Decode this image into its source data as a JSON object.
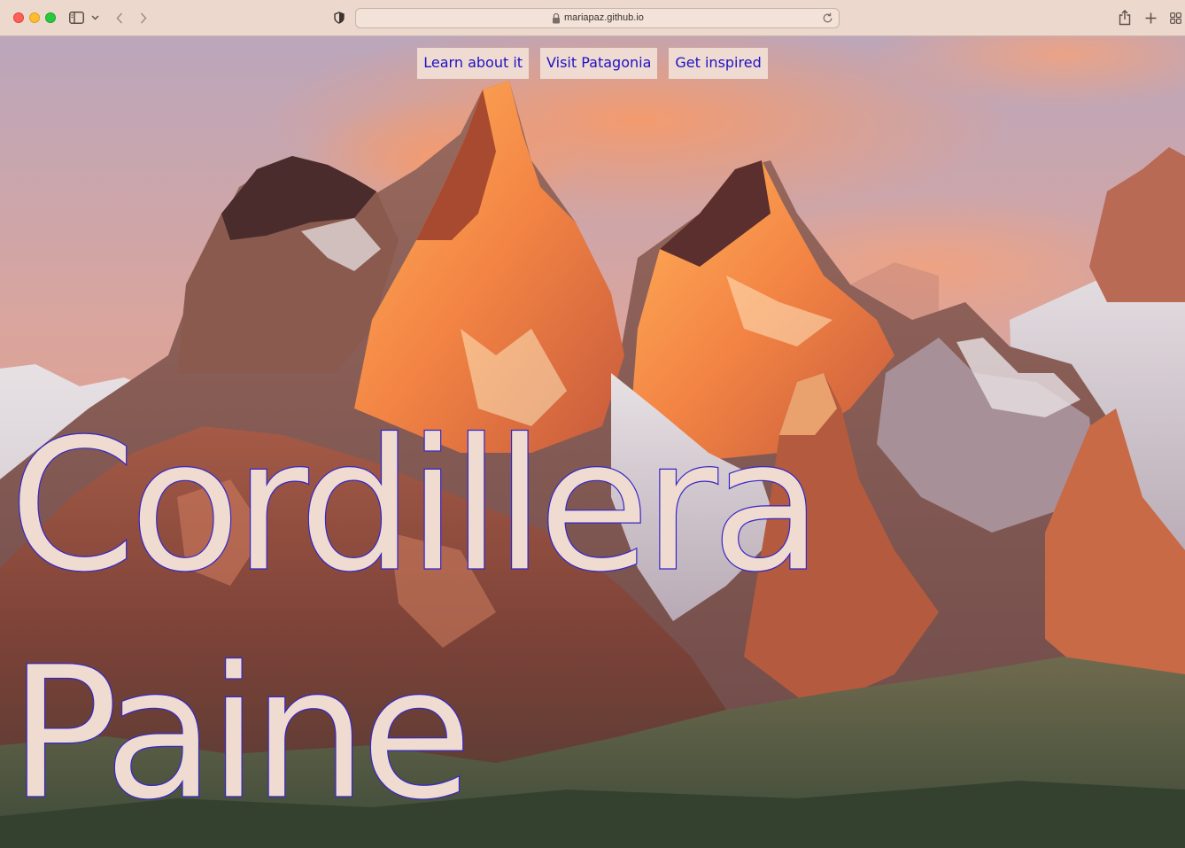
{
  "browser": {
    "address_bar": {
      "url": "mariapaz.github.io"
    }
  },
  "page": {
    "nav": {
      "links": [
        {
          "label": "Learn about it"
        },
        {
          "label": "Visit Patagonia"
        },
        {
          "label": "Get inspired"
        }
      ]
    },
    "hero": {
      "title_line_1": "Cordillera",
      "title_line_2": "Paine",
      "background": "Torres del Paine mountain peaks at sunrise"
    }
  },
  "colors": {
    "toolbar_bg": "#ecd8cc",
    "nav_button_bg": "#efdbd1",
    "link_text": "#1f12c4",
    "headline_fill": "#f0dbd0",
    "headline_outline": "#3527c8"
  },
  "icons": [
    "sidebar-icon",
    "chevron-down-icon",
    "back-arrow-icon",
    "forward-arrow-icon",
    "privacy-shield-icon",
    "lock-icon",
    "reload-icon",
    "share-icon",
    "plus-icon",
    "tab-overview-icon"
  ]
}
